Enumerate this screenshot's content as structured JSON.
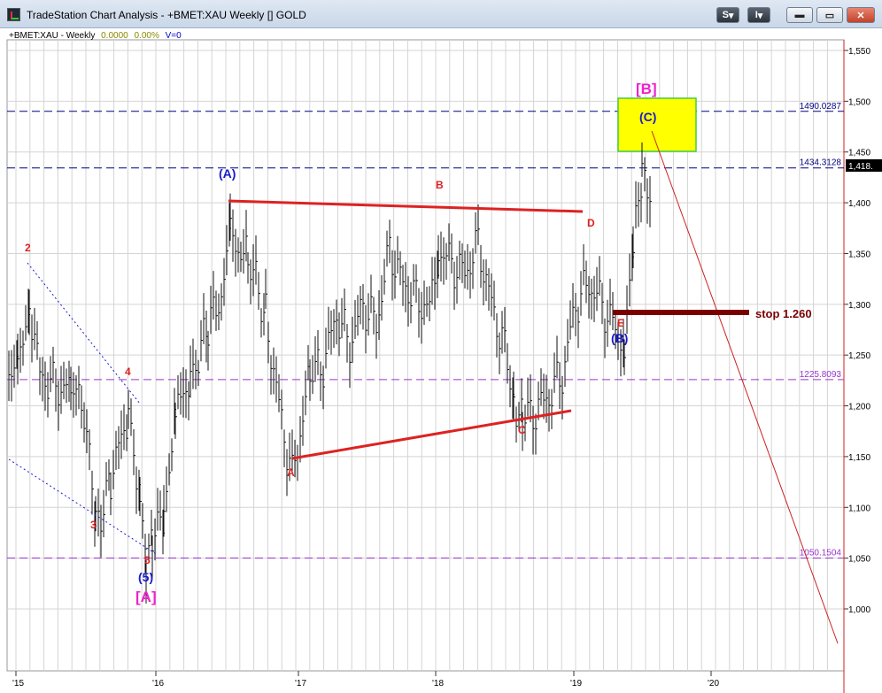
{
  "window": {
    "title": "TradeStation Chart Analysis - +BMET:XAU Weekly [] GOLD",
    "btn_s": "S",
    "btn_i": "I",
    "btn_min": "▬",
    "btn_max": "▭",
    "btn_close": "✕"
  },
  "info_bar": {
    "symbol": "+BMET:XAU - Weekly",
    "value": "0.0000",
    "pct": "0.00%",
    "volume": "V=0"
  },
  "chart_data": {
    "type": "candlestick-weekly",
    "symbol": "+BMET:XAU",
    "y_ticks": [
      "1,550",
      "1,500",
      "1,450",
      "1,400",
      "1,350",
      "1,300",
      "1,250",
      "1,200",
      "1,150",
      "1,100",
      "1,050",
      "1,000"
    ],
    "y_values": [
      1550,
      1500,
      1450,
      1400,
      1350,
      1300,
      1250,
      1200,
      1150,
      1100,
      1050,
      1000
    ],
    "x_ticks": [
      "'15",
      "'16",
      "'17",
      "'18",
      "'19",
      "'20"
    ],
    "last_price": "1,418.",
    "hlines": [
      {
        "label": "1490.0287",
        "value": 1490.0287,
        "color": "#000080"
      },
      {
        "label": "1434.3128",
        "value": 1434.3128,
        "color": "#000080"
      },
      {
        "label": "1225.8093",
        "value": 1225.8093,
        "color": "#9933cc"
      },
      {
        "label": "1050.1504",
        "value": 1050.1504,
        "color": "#9933cc"
      }
    ],
    "wave_labels": {
      "red": [
        "2",
        "3",
        "4",
        "5",
        "A",
        "B",
        "C",
        "D",
        "E"
      ],
      "blue": [
        "(5)",
        "(A)",
        "(B)",
        "(C)"
      ],
      "magenta": [
        "[A]",
        "[B]"
      ]
    },
    "stop_label": "stop 1.260",
    "colors": {
      "red": "#dd2222",
      "blue": "#1a1acc",
      "magenta": "#ee22cc",
      "box": "#ffff00",
      "stop": "#7a0000"
    }
  }
}
